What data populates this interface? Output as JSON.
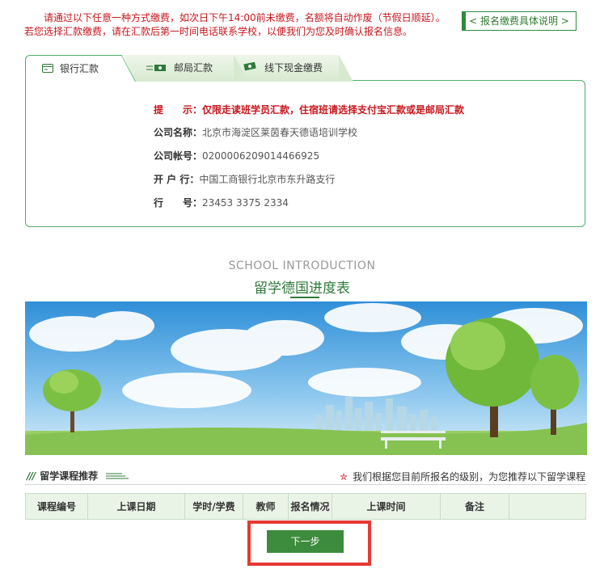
{
  "notice": {
    "line1": "请通过以下任意一种方式缴费，如次日下午14:00前未缴费，名额将自动作废（节假日顺延）。",
    "line2": "若您选择汇款缴费，请在汇款后第一时间电话联系学校，以便我们为您及时确认报名信息。"
  },
  "detail_button": "< 报名缴费具体说明 >",
  "tabs": [
    {
      "label": "银行汇款",
      "icon": "bank-card-icon",
      "active": true
    },
    {
      "label": "邮局汇款",
      "icon": "postal-order-icon",
      "active": false
    },
    {
      "label": "线下现金缴费",
      "icon": "cash-icon",
      "active": false
    }
  ],
  "bank_info": {
    "tip_key": "提　　示：",
    "tip_value": "仅限走读班学员汇款，住宿班请选择支付宝汇款或是邮局汇款",
    "company_key": "公司名称：",
    "company_value": "北京市海淀区莱茵春天德语培训学校",
    "account_key": "公司帐号：",
    "account_value": "0200006209014466925",
    "bank_key": "开 户 行：",
    "bank_value": "中国工商银行北京市东升路支行",
    "code_key": "行　　号：",
    "code_value": "23453 3375 2334"
  },
  "intro": {
    "en": "SCHOOL INTRODUCTION",
    "cn": "留学德国进度表"
  },
  "recommend": {
    "title": "留学课程推荐",
    "note": "我们根据您目前所报名的级别，为您推荐以下留学课程"
  },
  "table_headers": [
    "课程编号",
    "上课日期",
    "学时/学费",
    "教师",
    "报名情况",
    "上课时间",
    "备注",
    ""
  ],
  "next_button": "下一步",
  "colors": {
    "accent": "#3d8b3d",
    "warning": "#c8161d",
    "border": "#4caf6a"
  }
}
